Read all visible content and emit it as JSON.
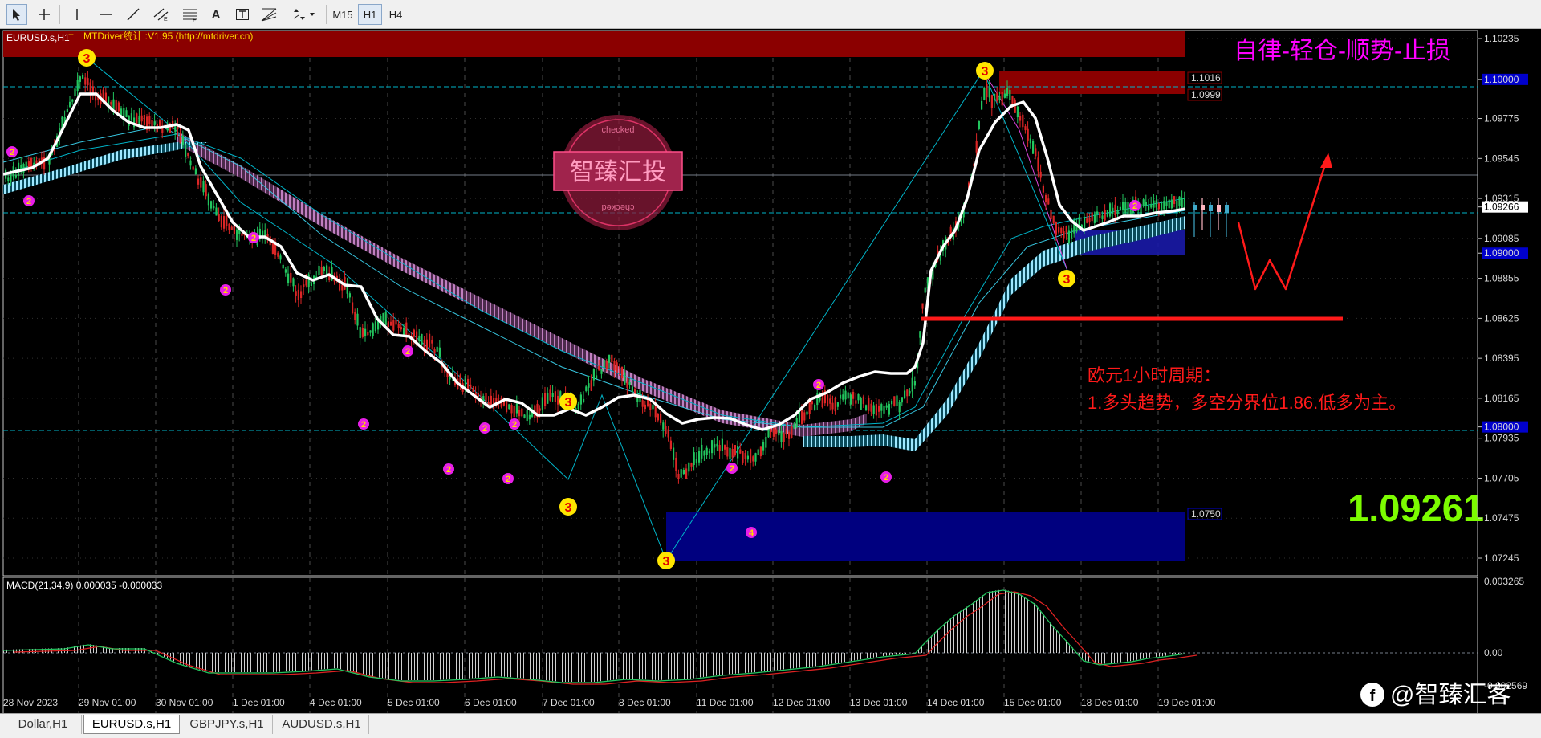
{
  "toolbar": {
    "tools": [
      "cursor",
      "crosshair",
      "vertical-line",
      "horizontal-line",
      "trendline",
      "equidistant-channel",
      "fibonacci",
      "text",
      "text-label",
      "fibo-fan",
      "arrows"
    ],
    "text_tool_label": "A",
    "timeframes": [
      "M15",
      "H1",
      "H4"
    ],
    "active_timeframe": "H1"
  },
  "chart": {
    "symbol_label": "EURUSD.s,H1",
    "indicator_label": "MTDriver统计 :V1.95 (http://mtdriver.cn)",
    "slogan": "自律-轻仓-顺势-止损",
    "watermark": {
      "brand": "智臻汇投",
      "stamp_top": "checked",
      "stamp_bottom": "checked"
    },
    "analysis": {
      "line1": "欧元1小时周期：",
      "line2": "1.多头趋势，多空分界位1.86.低多为主。"
    },
    "current_price": "1.09261",
    "price_axis": [
      "1.10235",
      "1.10000",
      "1.09775",
      "1.09545",
      "1.09315",
      "1.09266",
      "1.09085",
      "1.09000",
      "1.08855",
      "1.08625",
      "1.08395",
      "1.08165",
      "1.08000",
      "1.07935",
      "1.07705",
      "1.07475",
      "1.07245"
    ],
    "price_highlights": {
      "1.10000": "#0000cc",
      "1.09266": "#ffffff",
      "1.09000": "#0000cc",
      "1.08000": "#0000cc"
    },
    "zone_labels": [
      "1.1016",
      "1.0999",
      "1.0750"
    ],
    "wave_labels": [
      "3",
      "2",
      "4"
    ],
    "x_axis": [
      "28 Nov 2023",
      "29 Nov 01:00",
      "30 Nov 01:00",
      "1 Dec 01:00",
      "4 Dec 01:00",
      "5 Dec 01:00",
      "6 Dec 01:00",
      "7 Dec 01:00",
      "8 Dec 01:00",
      "11 Dec 01:00",
      "12 Dec 01:00",
      "13 Dec 01:00",
      "14 Dec 01:00",
      "15 Dec 01:00",
      "18 Dec 01:00",
      "19 Dec 01:00"
    ],
    "colors": {
      "bull": "#22c55e",
      "bear": "#dc2626",
      "support": "#ff1a1a",
      "zone_top": "#8b0000",
      "zone_bottom": "#00007f",
      "slogan": "#ff00ff",
      "price_big": "#7cfc00"
    }
  },
  "macd": {
    "label": "MACD(21,34,9) 0.000035 -0.000033",
    "axis": [
      "0.003265",
      "0.00",
      "-0.002569"
    ]
  },
  "social": {
    "handle": "@智臻汇客"
  },
  "tabs": [
    "Dollar,H1",
    "EURUSD.s,H1",
    "GBPJPY.s,H1",
    "AUDUSD.s,H1"
  ],
  "active_tab": "EURUSD.s,H1"
}
